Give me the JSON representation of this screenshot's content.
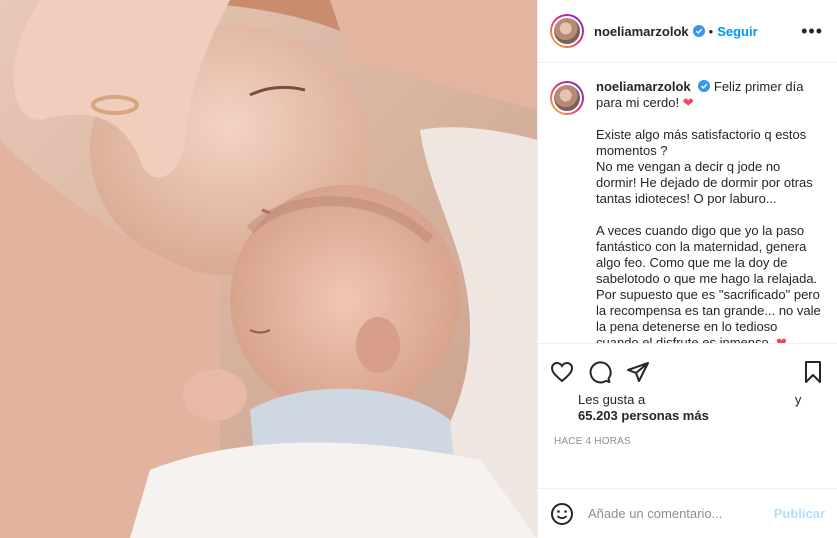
{
  "post": {
    "username": "noeliamarzolok",
    "follow_label": "Seguir",
    "more_label": "•••"
  },
  "caption": {
    "username": "noeliamarzolok",
    "line1": "Feliz primer día para mi cerdo! ",
    "para2": "Existe algo más satisfactorio q estos momentos ?\nNo me vengan a decir q jode no dormir! He dejado de dormir por otras tantas idioteces! O por laburo...",
    "para3": "A veces cuando digo que yo la paso fantástico con la maternidad, genera algo feo. Como que me la doy de sabelotodo o que me hago la relajada.\nPor supuesto que es \"sacrificado\" pero la recompensa es tan grande... no vale la pena detenerse en lo tedioso cuando el disfrute es inmenso. ",
    "heart": "❤"
  },
  "likes": {
    "prefix": "Les gusta a",
    "and": "y",
    "count": "65.203 personas más"
  },
  "timestamp": "Hace 4 horas",
  "comment": {
    "placeholder": "Añade un comentario...",
    "publish_label": "Publicar"
  },
  "colors": {
    "accent": "#0095f6",
    "publish_disabled": "#b2dffc",
    "heart": "#ed4956",
    "muted": "#8e8e8e"
  },
  "icons": [
    "verified-icon",
    "heart-icon",
    "comment-icon",
    "share-icon",
    "bookmark-icon",
    "emoji-icon",
    "more-icon"
  ]
}
